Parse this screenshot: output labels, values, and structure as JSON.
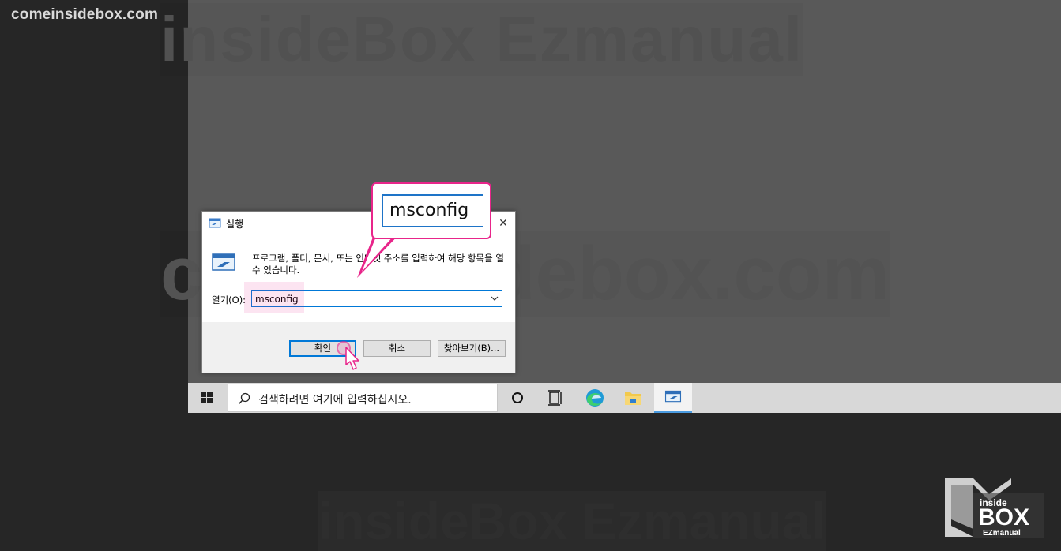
{
  "watermark": {
    "site": "comeinsidebox.com",
    "top_text": "insideBox Ezmanual",
    "mid_text": "comeinsidebox.com",
    "bottom_text": "insideBox Ezmanual"
  },
  "run_dialog": {
    "title": "실행",
    "close_label": "✕",
    "description": "프로그램, 폴더, 문서, 또는 인터넷 주소를 입력하여 해당 항목을 열 수 있습니다.",
    "open_label": "열기(O):",
    "open_value": "msconfig",
    "ok_label": "확인",
    "cancel_label": "취소",
    "browse_label": "찾아보기(B)..."
  },
  "callout": {
    "text": "msconfig",
    "color": "#e8258a"
  },
  "taskbar": {
    "search_placeholder": "검색하려면 여기에 입력하십시오.",
    "icons": [
      "windows-start-icon",
      "search-icon",
      "cortana-icon",
      "task-view-icon",
      "edge-icon",
      "file-explorer-icon",
      "run-icon"
    ]
  },
  "logo": {
    "inside": "inside",
    "box": "BOX",
    "ez": "EZmanual"
  }
}
